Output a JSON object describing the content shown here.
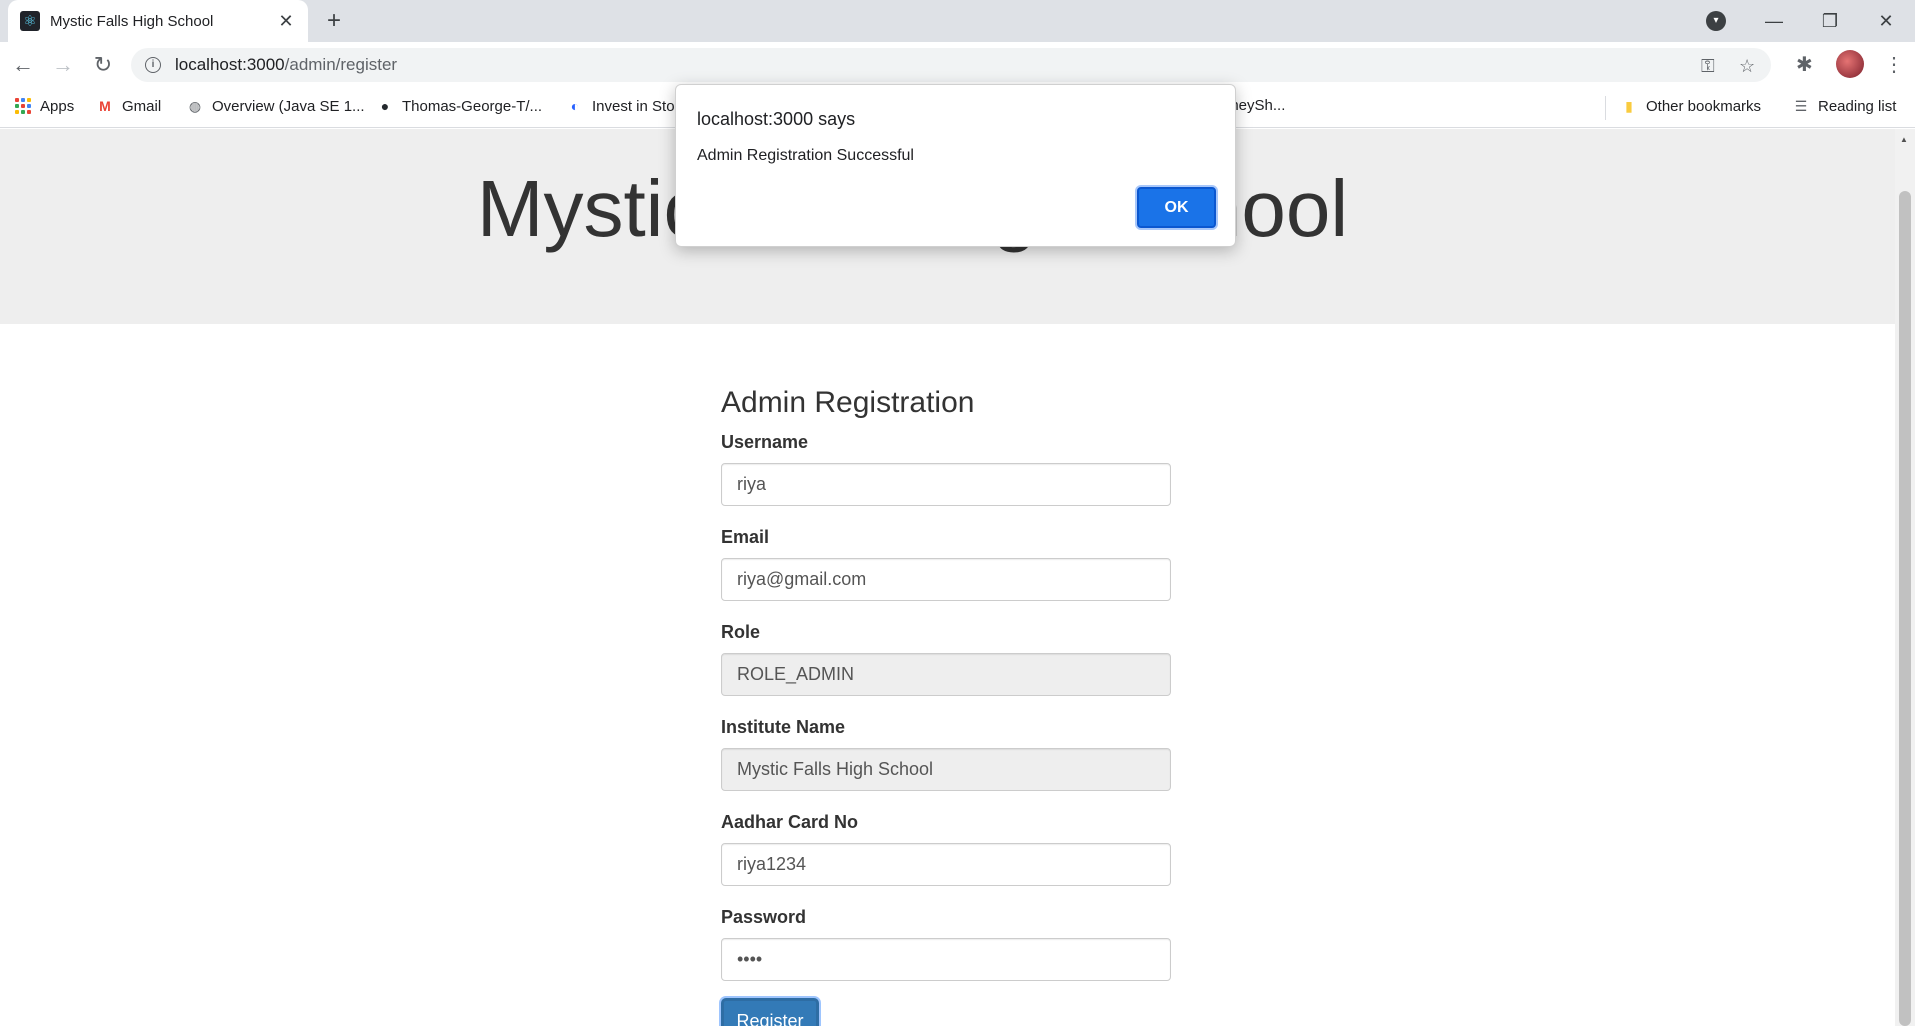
{
  "browser": {
    "tab_title": "Mystic Falls High School",
    "tab_close": "✕",
    "new_tab": "+",
    "url_host": "localhost:3000",
    "url_path": "/admin/register",
    "bookmarks": [
      {
        "label": "Apps",
        "icon": "apps-grid-icon"
      },
      {
        "label": "Gmail",
        "icon": "gmail-icon"
      },
      {
        "label": "Overview (Java SE 1...",
        "icon": "globe-icon"
      },
      {
        "label": "Thomas-George-T/...",
        "icon": "github-icon"
      },
      {
        "label": "Invest in Sto",
        "icon": "invest-icon"
      },
      {
        "label": "dneySh...",
        "icon": "bookmark-icon"
      }
    ],
    "other_bookmarks": "Other bookmarks",
    "reading_list": "Reading list"
  },
  "dialog": {
    "title": "localhost:3000 says",
    "message": "Admin Registration Successful",
    "ok_label": "OK"
  },
  "page": {
    "heading": "Mystic Falls High School",
    "form_title": "Admin Registration",
    "fields": [
      {
        "label": "Username",
        "value": "riya",
        "readonly": false
      },
      {
        "label": "Email",
        "value": "riya@gmail.com",
        "readonly": false
      },
      {
        "label": "Role",
        "value": "ROLE_ADMIN",
        "readonly": true
      },
      {
        "label": "Institute Name",
        "value": "Mystic Falls High School",
        "readonly": true
      },
      {
        "label": "Aadhar Card No",
        "value": "riya1234",
        "readonly": false
      },
      {
        "label": "Password",
        "value": "riya",
        "readonly": false
      }
    ],
    "register_label": "Register"
  },
  "colors": {
    "primary": "#337ab7",
    "dialog_button": "#1a73e8",
    "jumbotron_bg": "#eeeeee"
  }
}
